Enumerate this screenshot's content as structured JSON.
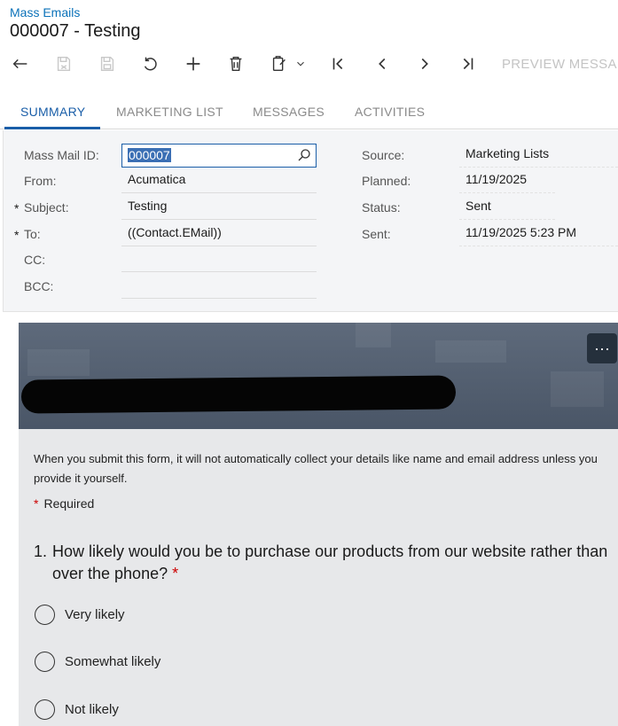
{
  "breadcrumb": "Mass Emails",
  "title": "000007 - Testing",
  "toolbar": {
    "buttons": [
      "back-icon",
      "save-close-icon",
      "save-icon",
      "undo-icon",
      "add-icon",
      "delete-icon",
      "copy-paste-icon",
      "first-icon",
      "previous-icon",
      "next-icon",
      "last-icon"
    ],
    "preview_label": "PREVIEW MESSA"
  },
  "tabs": [
    {
      "label": "SUMMARY",
      "active": true
    },
    {
      "label": "MARKETING LIST",
      "active": false
    },
    {
      "label": "MESSAGES",
      "active": false
    },
    {
      "label": "ACTIVITIES",
      "active": false
    }
  ],
  "form": {
    "mass_mail_id_label": "Mass Mail ID:",
    "mass_mail_id_value": "000007",
    "from_label": "From:",
    "from_value": "Acumatica",
    "subject_label": "Subject:",
    "subject_value": "Testing",
    "to_label": "To:",
    "to_value": "((Contact.EMail))",
    "cc_label": "CC:",
    "cc_value": "",
    "bcc_label": "BCC:",
    "bcc_value": "",
    "required_marker": "*",
    "source_label": "Source:",
    "source_value": "Marketing Lists",
    "planned_label": "Planned:",
    "planned_value": "11/19/2025",
    "status_label": "Status:",
    "status_value": "Sent",
    "sent_label": "Sent:",
    "sent_value": "11/19/2025 5:23 PM"
  },
  "preview": {
    "more_label": "···",
    "intro": "When you submit this form, it will not automatically collect your details like name and email address unless you provide it yourself.",
    "required_star": "*",
    "required_text": "Required",
    "question_number": "1.",
    "question_text": "How likely would you be to purchase our products from our website rather than over the phone?",
    "question_star": "*",
    "options": [
      "Very likely",
      "Somewhat likely",
      "Not likely"
    ]
  },
  "colors": {
    "link": "#0b72b9",
    "accent": "#1a5ea8",
    "required": "#cc0000",
    "banner": "#55616f"
  }
}
